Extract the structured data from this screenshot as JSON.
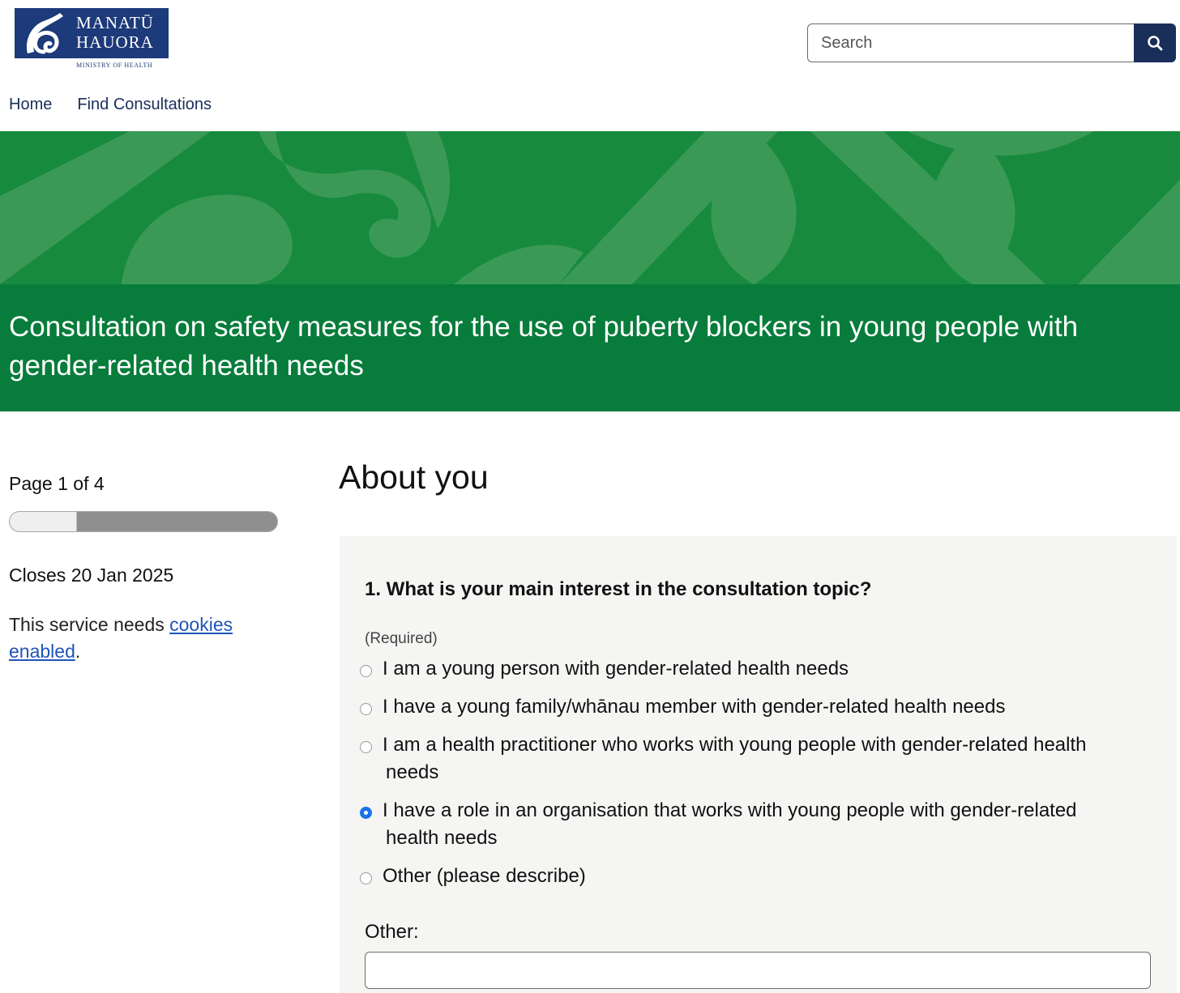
{
  "brand": {
    "line1": "MANATŪ",
    "line2": "HAUORA",
    "subline": "MINISTRY OF HEALTH",
    "navy": "#1d3a7a"
  },
  "search": {
    "placeholder": "Search",
    "icon": "search-icon"
  },
  "nav": {
    "items": [
      "Home",
      "Find Consultations"
    ]
  },
  "banner": {
    "pattern_color": "#178a3e",
    "title_band_color": "#087c3b",
    "title": "Consultation on safety measures for the use of puberty blockers in young people with gender-related health needs"
  },
  "sidebar": {
    "page_indicator": "Page 1 of 4",
    "progress_fraction": 0.25,
    "closes": "Closes 20 Jan 2025",
    "cookies_prefix": "This service needs ",
    "cookies_link": "cookies enabled",
    "cookies_suffix": "."
  },
  "main": {
    "section_title": "About you",
    "question": "1. What is your main interest in the consultation topic?",
    "required": "(Required)",
    "options": [
      {
        "line1": "I am a young person with gender-related health needs",
        "line2": "",
        "checked": false
      },
      {
        "line1": "I have a young family/whānau member with gender-related health needs",
        "line2": "",
        "checked": false
      },
      {
        "line1": "I am a health practitioner who works with young people with gender-related health",
        "line2": "needs",
        "checked": false
      },
      {
        "line1": "I have a role in an organisation that works with young people with gender-related",
        "line2": "health needs",
        "checked": true
      },
      {
        "line1": "Other (please describe)",
        "line2": "",
        "checked": false
      }
    ],
    "other_label": "Other:",
    "other_value": ""
  }
}
